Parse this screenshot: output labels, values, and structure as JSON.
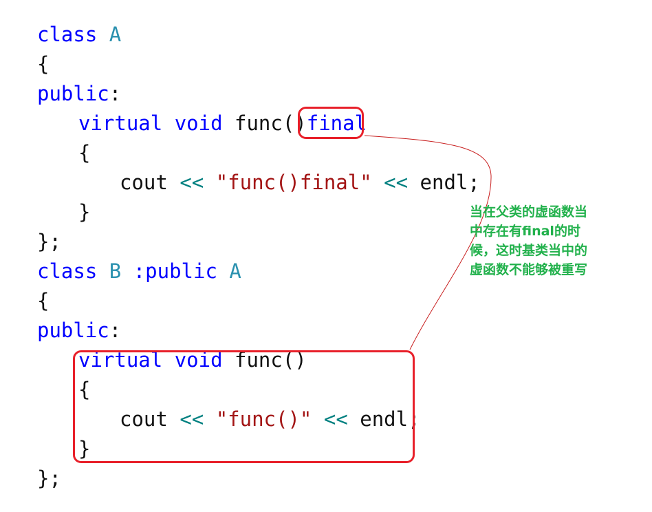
{
  "code": {
    "class_kw": "class",
    "public_kw": "public",
    "virtual_kw": "virtual",
    "void_kw": "void",
    "final_kw": "final",
    "cout": "cout",
    "endl": "endl",
    "shift_op": "<<",
    "class_a_name": "A",
    "class_b_name": "B",
    "func_name": "func",
    "parens": "()",
    "open_brace": "{",
    "close_brace": "}",
    "close_brace_semi": "};",
    "colon": ":",
    "base_public": ":public",
    "semicolon": ";",
    "string_a": "\"func()final\"",
    "string_b": "\"func()\""
  },
  "annotation": {
    "lines": [
      "当在父类的虚函数当",
      "中存在有final的时",
      "候，这时基类当中的",
      "虚函数不能够被重写"
    ],
    "text_color": "#22b14c",
    "box_color": "#e8202a",
    "connector_color": "#c81e1e"
  },
  "colors": {
    "keyword": "#0000ff",
    "type": "#2b91af",
    "operator": "#008080",
    "string": "#a31515",
    "default": "#111111"
  }
}
